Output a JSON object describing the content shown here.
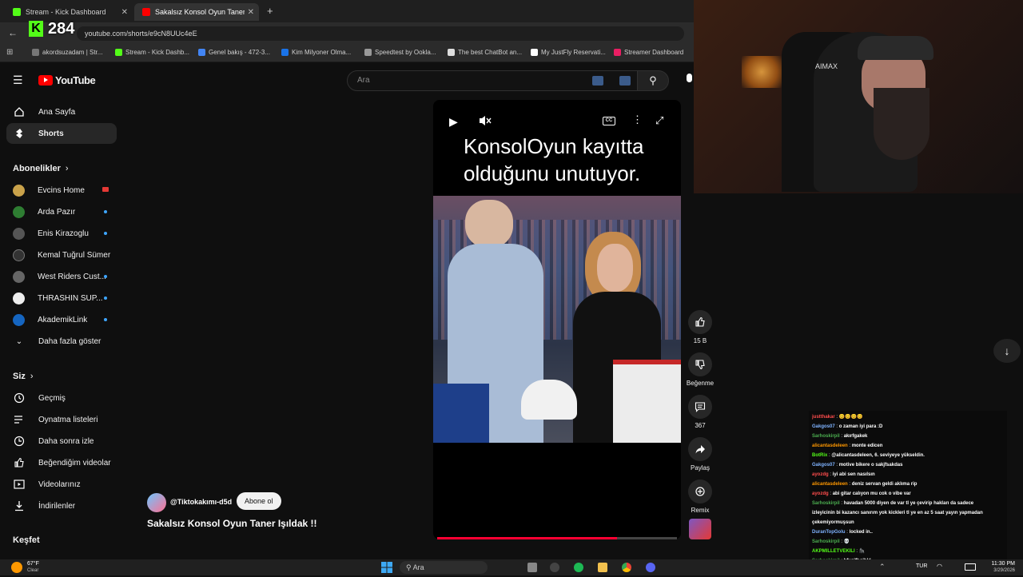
{
  "tabs": [
    {
      "title": "Stream - Kick Dashboard",
      "favicon_color": "#53fc18"
    },
    {
      "title": "Sakalsız Konsol Oyun Taner Işıl",
      "favicon_color": "#ff0000"
    }
  ],
  "kick_overlay": {
    "viewer_count": "284",
    "logo": "K"
  },
  "url": "youtube.com/shorts/e9cN8UUc4eE",
  "bookmarks": [
    {
      "label": "akordsuzadam | Str...",
      "color": "#777"
    },
    {
      "label": "Stream - Kick Dashb...",
      "color": "#53fc18"
    },
    {
      "label": "Genel bakış - 472-3...",
      "color": "#4285f4"
    },
    {
      "label": "Kim Milyoner Olma...",
      "color": "#1a73e8"
    },
    {
      "label": "Speedtest by Ookla...",
      "color": "#999"
    },
    {
      "label": "The best ChatBot an...",
      "color": "#ddd"
    },
    {
      "label": "My JustFly Reservati...",
      "color": "#fff"
    },
    {
      "label": "Streamer Dashboard",
      "color": "#e91e63"
    }
  ],
  "youtube": {
    "logo_text": "YouTube",
    "search_placeholder": "Ara",
    "nav": [
      {
        "label": "Ana Sayfa",
        "icon": "home-icon"
      },
      {
        "label": "Shorts",
        "icon": "shorts-icon",
        "active": true
      }
    ],
    "subscriptions_heading": "Abonelikler",
    "subscriptions": [
      {
        "label": "Evcins Home",
        "color": "#c9a24a",
        "live": true
      },
      {
        "label": "Arda Pazır",
        "color": "#2e7d32"
      },
      {
        "label": "Enis Kirazoglu",
        "color": "#555"
      },
      {
        "label": "Kemal Tuğrul Sümer",
        "color": "#333"
      },
      {
        "label": "West Riders Cust...",
        "color": "#666"
      },
      {
        "label": "THRASHIN SUP...",
        "color": "#eee"
      },
      {
        "label": "AkademikLink",
        "color": "#1565c0"
      }
    ],
    "show_more": "Daha fazla göster",
    "you_heading": "Siz",
    "you_items": [
      {
        "label": "Geçmiş",
        "icon": "history-icon"
      },
      {
        "label": "Oynatma listeleri",
        "icon": "playlist-icon"
      },
      {
        "label": "Daha sonra izle",
        "icon": "watch-later-icon"
      },
      {
        "label": "Beğendiğim videolar",
        "icon": "liked-icon"
      },
      {
        "label": "Videolarınız",
        "icon": "your-videos-icon"
      },
      {
        "label": "İndirilenler",
        "icon": "downloads-icon"
      }
    ],
    "explore_heading": "Keşfet",
    "video": {
      "caption": "KonsolOyun kayıtta olduğunu unutuyor.",
      "channel": "@Tiktokakımı-d5d",
      "subscribe": "Abone ol",
      "title": "Sakalsız Konsol Oyun Taner Işıldak !!",
      "progress": 0.75
    },
    "actions": [
      {
        "label": "15 B",
        "icon": "like-icon"
      },
      {
        "label": "Beğenme",
        "icon": "dislike-icon"
      },
      {
        "label": "367",
        "icon": "comment-icon"
      },
      {
        "label": "Paylaş",
        "icon": "share-icon"
      },
      {
        "label": "Remix",
        "icon": "remix-icon"
      }
    ]
  },
  "chat": [
    {
      "user": "justthakar",
      "color": "#ff4d4d",
      "msg": "😊😊😊😊"
    },
    {
      "user": "Gakgos07",
      "color": "#7fb3ff",
      "msg": "o zaman iyi para :D"
    },
    {
      "user": "Sarhoskirpil",
      "color": "#4caf50",
      "msg": "akırfgakek"
    },
    {
      "user": "alicantasdeleen",
      "color": "#ff9800",
      "msg": "monte edicen"
    },
    {
      "user": "BotRix",
      "color": "#53fc18",
      "msg": "@alicantasdeleen, 6. seviyeye yükseldin."
    },
    {
      "user": "Gakgos07",
      "color": "#7fb3ff",
      "msg": "motive bikere o sakjfsakdas"
    },
    {
      "user": "ayozdg",
      "color": "#ff4d4d",
      "msg": "iyi abi sen nasılsın"
    },
    {
      "user": "alicantasdeleen",
      "color": "#ff9800",
      "msg": "deniz servan geldi aklıma rip"
    },
    {
      "user": "ayozdg",
      "color": "#ff4d4d",
      "msg": "abi gitar calıyon mu cok o vibe var"
    },
    {
      "user": "Sarhoskirpil",
      "color": "#4caf50",
      "msg": "havadan 5000 diyen de var tl ye çevirip hakları da sadece"
    },
    {
      "user": "",
      "color": "#fff",
      "msg": "izleyicinin bi kazancı sanırım yok kickleri tl ye en az 5 saat yayın yapmadan"
    },
    {
      "user": "",
      "color": "#fff",
      "msg": "çekemiyormuşsun"
    },
    {
      "user": "DuranTopGolu",
      "color": "#7fb3ff",
      "msg": "locked in.."
    },
    {
      "user": "Sarhoskirpil",
      "color": "#4caf50",
      "msg": "💀"
    },
    {
      "user": "AKPMILLETVEKILI",
      "color": "#53fc18",
      "msg": "🦍"
    },
    {
      "user": "Sarhoskirpil",
      "color": "#4caf50",
      "msg": "hfxgjfbgjhkl"
    }
  ],
  "taskbar": {
    "weather_temp": "67°F",
    "weather_desc": "Clear",
    "search": "Ara",
    "lang": "TUR",
    "time": "11:30 PM",
    "date": "3/29/2026"
  }
}
